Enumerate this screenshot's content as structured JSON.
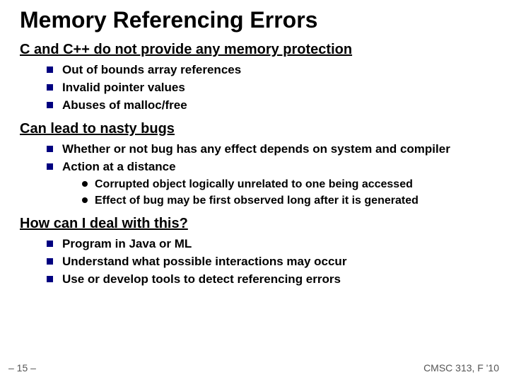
{
  "title": "Memory Referencing Errors",
  "sections": [
    {
      "heading": "C and C++ do not provide any memory protection",
      "items": [
        {
          "text": "Out of bounds array references"
        },
        {
          "text": "Invalid pointer values"
        },
        {
          "text": "Abuses of malloc/free"
        }
      ]
    },
    {
      "heading": "Can lead to nasty bugs",
      "items": [
        {
          "text": "Whether or not bug has any effect depends on system and compiler"
        },
        {
          "text": "Action at a distance",
          "subitems": [
            "Corrupted object logically unrelated to one being accessed",
            "Effect of bug may be first observed long after it is generated"
          ]
        }
      ]
    },
    {
      "heading": "How can I deal with this?",
      "items": [
        {
          "text": "Program in Java or ML"
        },
        {
          "text": "Understand what possible interactions may occur"
        },
        {
          "text": "Use or develop tools to detect referencing errors"
        }
      ]
    }
  ],
  "footer": {
    "left": "– 15 –",
    "right": "CMSC 313, F '10"
  }
}
